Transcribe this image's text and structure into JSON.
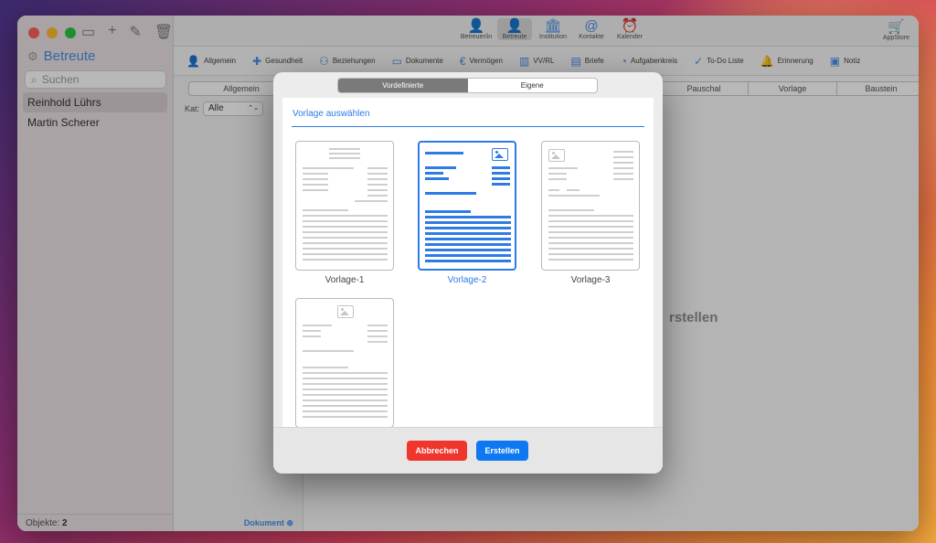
{
  "sidebar": {
    "title": "Betreute",
    "search_placeholder": "Suchen",
    "persons": [
      "Reinhold Lührs",
      "Martin Scherer"
    ],
    "footer_label": "Objekte:",
    "footer_count": "2"
  },
  "toolbar": {
    "items": [
      "Betreuer/in",
      "Betreute",
      "Institution",
      "Kontakte",
      "Kalender"
    ],
    "appstore": "AppStore"
  },
  "tabs": [
    "Allgemein",
    "Gesundheit",
    "Beziehungen",
    "Dokumente",
    "Vermögen",
    "VV/RL",
    "Briefe",
    "Aufgabenkreis",
    "To-Do Liste",
    "Erinnerung",
    "Notiz"
  ],
  "column": {
    "segment": "Allgemein",
    "kat_label": "Kat:",
    "kat_value": "Alle",
    "dokument_link": "Dokument"
  },
  "main": {
    "segments": [
      "Pauschal",
      "Vorlage",
      "Baustein"
    ],
    "bg_text": "rstellen"
  },
  "modal": {
    "seg_left": "Vordefinierte",
    "seg_right": "Eigene",
    "heading": "Vorlage auswählen",
    "templates": [
      "Vorlage-1",
      "Vorlage-2",
      "Vorlage-3",
      ""
    ],
    "cancel": "Abbrechen",
    "create": "Erstellen",
    "accent": "#2f7be5"
  }
}
